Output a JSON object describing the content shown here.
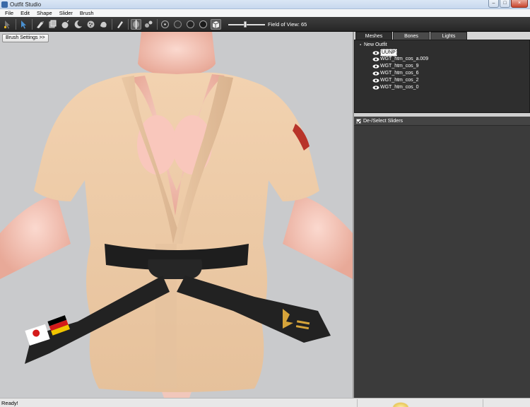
{
  "window": {
    "title": "Outfit Studio"
  },
  "menu": [
    "File",
    "Edit",
    "Shape",
    "Slider",
    "Brush"
  ],
  "toolbar": {
    "fov_label": "Field of View: 65",
    "fov_value": 65
  },
  "viewport": {
    "brush_settings_label": "Brush Settings >>"
  },
  "panel": {
    "tabs": [
      "Meshes",
      "Bones",
      "Lights"
    ],
    "active_tab": "Meshes",
    "tree_root": "New Outfit",
    "meshes": [
      "UUNP",
      "WGT_htm_cos_a.009",
      "WGT_htm_cos_9",
      "WGT_htm_cos_6",
      "WGT_htm_cos_2",
      "WGT_htm_cos_0"
    ],
    "selected_mesh": "UUNP",
    "sliders_toggle_label": "De-/Select Sliders"
  },
  "status": {
    "text": "Ready!"
  },
  "colors": {
    "toolbar_bg": "#2f2f2f",
    "panel_bg": "#3b3b3b",
    "viewport_bg": "#c9cacc"
  }
}
